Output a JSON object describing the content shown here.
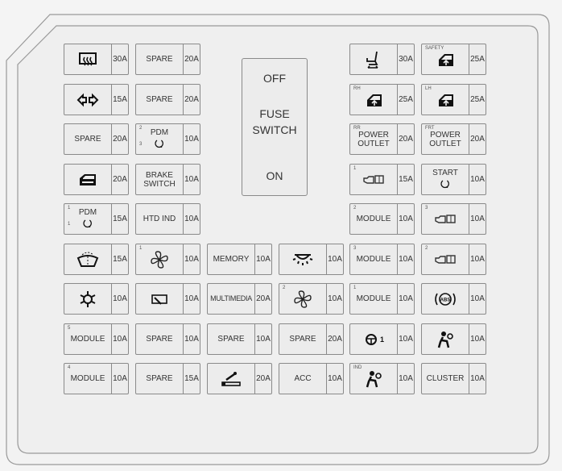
{
  "switch": {
    "off_label": "OFF",
    "title_line1": "FUSE",
    "title_line2": "SWITCH",
    "on_label": "ON"
  },
  "rows": [
    [
      {
        "icon": "rear-defrost-icon",
        "amp": "30A"
      },
      {
        "text": [
          "SPARE"
        ],
        "amp": "20A"
      },
      null,
      null,
      {
        "icon": "seat-adjust-icon",
        "amp": "30A"
      },
      {
        "icon": "power-window-icon",
        "tag": "SAFETY",
        "amp": "25A"
      }
    ],
    [
      {
        "icon": "turn-signal-icon",
        "amp": "15A"
      },
      {
        "text": [
          "SPARE"
        ],
        "amp": "20A"
      },
      null,
      null,
      {
        "icon": "power-window-icon",
        "tag": "RH",
        "amp": "25A"
      },
      {
        "icon": "power-window-icon",
        "tag": "LH",
        "amp": "25A"
      }
    ],
    [
      {
        "text": [
          "SPARE"
        ],
        "amp": "20A"
      },
      {
        "text": [
          "PDM"
        ],
        "icon": "ignition-icon",
        "tag": "2",
        "tag2": "3",
        "amp": "10A"
      },
      null,
      null,
      {
        "text": [
          "POWER",
          "OUTLET"
        ],
        "tag": "RR",
        "amp": "20A"
      },
      {
        "text": [
          "POWER",
          "OUTLET"
        ],
        "tag": "FRT",
        "amp": "20A"
      }
    ],
    [
      {
        "icon": "door-lock-icon",
        "amp": "20A"
      },
      {
        "text": [
          "BRAKE",
          "SWITCH"
        ],
        "amp": "10A"
      },
      null,
      null,
      {
        "icon": "engine-module-icon",
        "tag": "1",
        "amp": "15A"
      },
      {
        "text": [
          "START"
        ],
        "icon": "ignition-icon",
        "amp": "10A"
      }
    ],
    [
      {
        "text": [
          "PDM"
        ],
        "icon": "ignition-icon",
        "tag": "1",
        "tag2": "1",
        "amp": "15A"
      },
      {
        "text": [
          "HTD IND"
        ],
        "amp": "10A"
      },
      null,
      null,
      {
        "text": [
          "MODULE"
        ],
        "tag": "2",
        "amp": "10A"
      },
      {
        "icon": "engine-module-icon",
        "tag": "3",
        "amp": "10A"
      }
    ],
    [
      {
        "icon": "washer-icon",
        "amp": "15A"
      },
      {
        "icon": "blower-fan-icon",
        "tag": "1",
        "amp": "10A"
      },
      {
        "text": [
          "MEMORY"
        ],
        "amp": "10A"
      },
      {
        "icon": "room-lamp-icon",
        "amp": "10A"
      },
      {
        "text": [
          "MODULE"
        ],
        "tag": "3",
        "amp": "10A"
      },
      {
        "icon": "engine-module-icon",
        "tag": "2",
        "amp": "10A"
      }
    ],
    [
      {
        "icon": "air-conditioner-icon",
        "amp": "10A"
      },
      {
        "icon": "mirror-heater-icon",
        "amp": "10A"
      },
      {
        "text": [
          "MULTIMEDIA"
        ],
        "small": true,
        "amp": "20A"
      },
      {
        "icon": "blower-fan-icon",
        "tag": "2",
        "amp": "10A"
      },
      {
        "text": [
          "MODULE"
        ],
        "tag": "1",
        "amp": "10A"
      },
      {
        "icon": "abs-warning-icon",
        "icon_text": "ABS",
        "amp": "10A"
      }
    ],
    [
      {
        "text": [
          "MODULE"
        ],
        "tag": "5",
        "amp": "10A"
      },
      {
        "text": [
          "SPARE"
        ],
        "amp": "10A"
      },
      {
        "text": [
          "SPARE"
        ],
        "amp": "10A"
      },
      {
        "text": [
          "SPARE"
        ],
        "amp": "20A"
      },
      {
        "icon": "steering-wheel-icon",
        "icon_text": "1",
        "amp": "10A"
      },
      {
        "icon": "airbag-icon",
        "amp": "10A"
      }
    ],
    [
      {
        "text": [
          "MODULE"
        ],
        "tag": "4",
        "amp": "10A"
      },
      {
        "text": [
          "SPARE"
        ],
        "amp": "15A"
      },
      {
        "icon": "cigar-lighter-icon",
        "amp": "20A"
      },
      {
        "text": [
          "ACC"
        ],
        "amp": "10A"
      },
      {
        "icon": "airbag-icon",
        "tag": "IND",
        "amp": "10A"
      },
      {
        "text": [
          "CLUSTER"
        ],
        "amp": "10A"
      }
    ]
  ]
}
